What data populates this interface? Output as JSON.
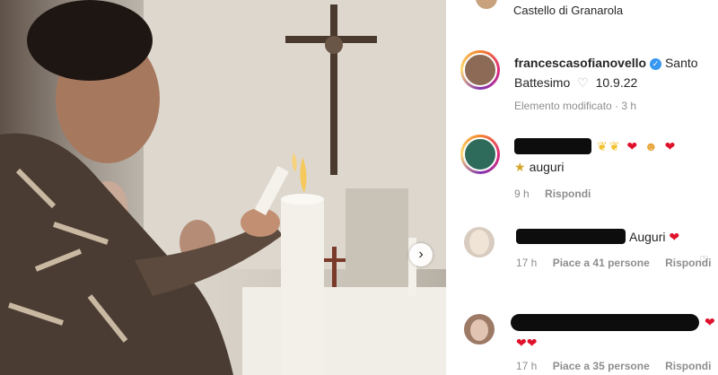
{
  "location": {
    "text": "Castello di Granarola"
  },
  "caption": {
    "username": "francescasofianovello",
    "text_part1": "Santo",
    "text_part2": "Battesimo",
    "date": "10.9.22",
    "meta": "Elemento modificato · 3 h"
  },
  "comments": [
    {
      "text_line1": "",
      "text_line2": "auguri",
      "time": "9 h",
      "reply_label": "Rispondi",
      "likes_label": ""
    },
    {
      "text_line1": "Auguri",
      "text_line2": "",
      "time": "17 h",
      "reply_label": "Rispondi",
      "likes_label": "Piace a 41 persone"
    },
    {
      "text_line1": "",
      "text_line2": "",
      "time": "17 h",
      "reply_label": "Rispondi",
      "likes_label": "Piace a 35 persone"
    }
  ],
  "icons": {
    "next": "chevron-right-icon",
    "verified": "verified-badge-icon",
    "like": "heart-outline-icon"
  },
  "colors": {
    "verified": "#3897f0",
    "heart": "#e0112b",
    "muted": "#8e8e8e"
  }
}
